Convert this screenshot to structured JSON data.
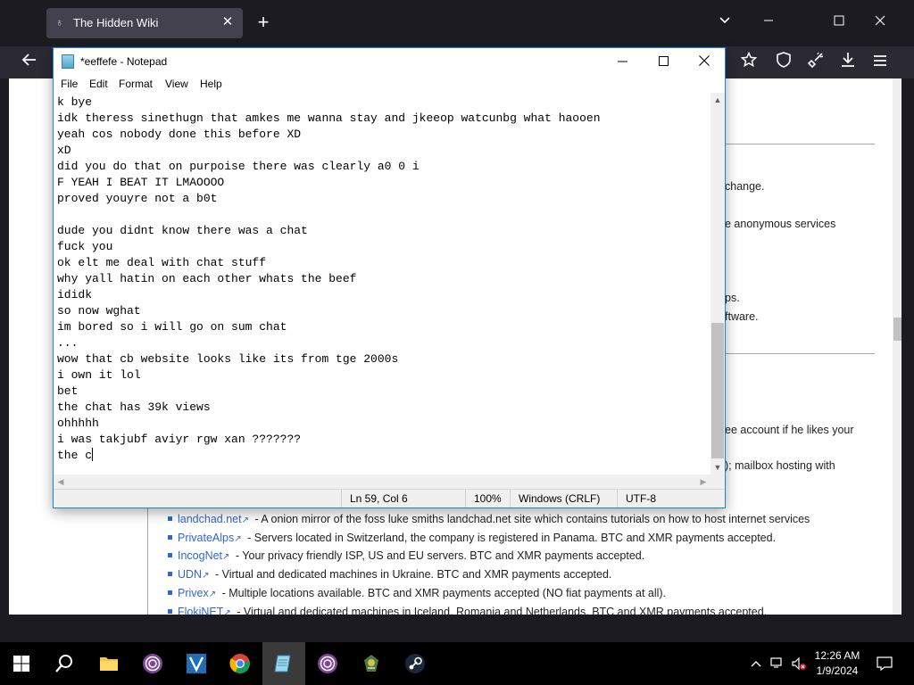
{
  "browser": {
    "tab_title": "The Hidden Wiki",
    "tab_close": "✕",
    "new_tab": "+",
    "page_fragments": [
      "change.",
      "e anonymous services",
      "ps.",
      "ftware.",
      "ee account if he likes your",
      "); mailbox hosting with"
    ],
    "links": [
      {
        "name": "landchad.net",
        "desc": " - A onion mirror of the foss luke smiths landchad.net site which contains tutorials on how to host internet services"
      },
      {
        "name": "PrivateAlps",
        "desc": " - Servers located in Switzerland, the company is registered in Panama. BTC and XMR payments accepted."
      },
      {
        "name": "IncogNet",
        "desc": " - Your privacy friendly ISP, US and EU servers. BTC and XMR payments accepted."
      },
      {
        "name": "UDN",
        "desc": " - Virtual and dedicated machines in Ukraine. BTC and XMR payments accepted."
      },
      {
        "name": "Privex",
        "desc": " - Multiple locations available. BTC and XMR payments accepted (NO fiat payments at all)."
      },
      {
        "name": "FlokiNET",
        "desc": " - Virtual and dedicated machines in Iceland, Romania and Netherlands. BTC and XMR payments accepted."
      }
    ]
  },
  "notepad": {
    "title": "*eeffefe - Notepad",
    "menu": [
      "File",
      "Edit",
      "Format",
      "View",
      "Help"
    ],
    "lines": [
      "k bye",
      "idk theress sinethugn that amkes me wanna stay and jkeeop watcunbg what haooen",
      "yeah cos nobody done this before XD",
      "xD",
      "did you do that on purpoise there was clearly a0 0 i",
      "F YEAH I BEAT IT LMAOOOO",
      "proved youyre not a b0t",
      "",
      "dude you didnt know there was a chat",
      "fuck you",
      "ok elt me deal with chat stuff",
      "why yall hatin on each other whats the beef",
      "ididk",
      "so now wghat",
      "im bored so i will go on sum chat",
      "...",
      "wow that cb website looks like its from tge 2000s",
      "i own it lol",
      "bet",
      "the chat has 39k views",
      "ohhhhh",
      "i was takjubf aviyr rgw xan ???????",
      "the c"
    ],
    "status": {
      "position": "Ln 59, Col 6",
      "zoom": "100%",
      "line_ending": "Windows (CRLF)",
      "encoding": "UTF-8"
    }
  },
  "taskbar": {
    "time": "12:26 AM",
    "date": "1/9/2024"
  }
}
